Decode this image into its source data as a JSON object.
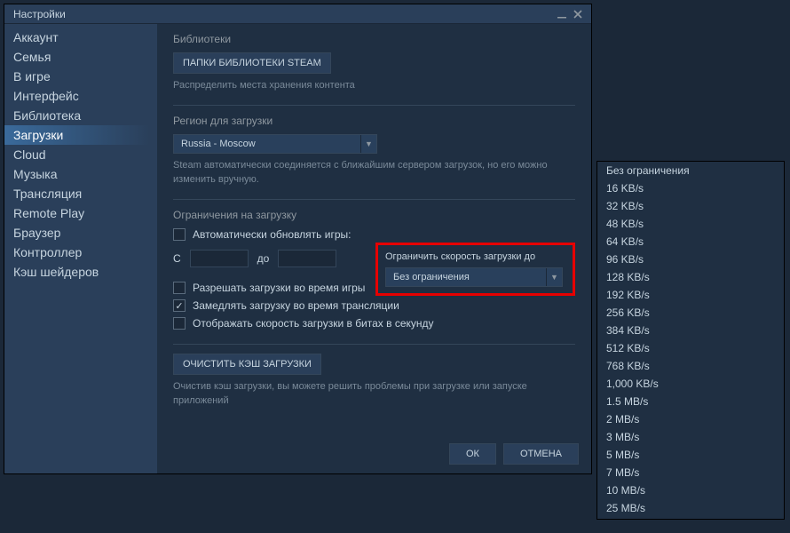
{
  "window": {
    "title": "Настройки"
  },
  "sidebar": {
    "items": [
      {
        "label": "Аккаунт",
        "selected": false
      },
      {
        "label": "Семья",
        "selected": false
      },
      {
        "label": "В игре",
        "selected": false
      },
      {
        "label": "Интерфейс",
        "selected": false
      },
      {
        "label": "Библиотека",
        "selected": false
      },
      {
        "label": "Загрузки",
        "selected": true
      },
      {
        "label": "Cloud",
        "selected": false
      },
      {
        "label": "Музыка",
        "selected": false
      },
      {
        "label": "Трансляция",
        "selected": false
      },
      {
        "label": "Remote Play",
        "selected": false
      },
      {
        "label": "Браузер",
        "selected": false
      },
      {
        "label": "Контроллер",
        "selected": false
      },
      {
        "label": "Кэш шейдеров",
        "selected": false
      }
    ]
  },
  "libraries": {
    "title": "Библиотеки",
    "button": "ПАПКИ БИБЛИОТЕКИ STEAM",
    "desc": "Распределить места хранения контента"
  },
  "region": {
    "title": "Регион для загрузки",
    "selected": "Russia - Moscow",
    "desc": "Steam автоматически соединяется с ближайшим сервером загрузок, но его можно изменить вручную."
  },
  "limits": {
    "title": "Ограничения на загрузку",
    "auto_update_label": "Автоматически обновлять игры:",
    "from_label": "C",
    "to_label": "до",
    "allow_in_game_label": "Разрешать загрузки во время игры",
    "throttle_stream_label": "Замедлять загрузку во время трансляции",
    "show_bits_label": "Отображать скорость загрузки в битах в секунду",
    "throttle_stream_checked": true,
    "limit_box_title": "Ограничить скорость загрузки до",
    "limit_selected": "Без ограничения"
  },
  "cache": {
    "button": "ОЧИСТИТЬ КЭШ ЗАГРУЗКИ",
    "desc": "Очистив кэш загрузки, вы можете решить проблемы при загрузке или запуске приложений"
  },
  "footer": {
    "ok": "ОК",
    "cancel": "ОТМЕНА"
  },
  "dropdown": {
    "items": [
      "Без ограничения",
      "16 KB/s",
      "32 KB/s",
      "48 KB/s",
      "64 KB/s",
      "96 KB/s",
      "128 KB/s",
      "192 KB/s",
      "256 KB/s",
      "384 KB/s",
      "512 KB/s",
      "768 KB/s",
      "1,000 KB/s",
      "1.5 MB/s",
      "2 MB/s",
      "3 MB/s",
      "5 MB/s",
      "7 MB/s",
      "10 MB/s",
      "25 MB/s"
    ]
  }
}
